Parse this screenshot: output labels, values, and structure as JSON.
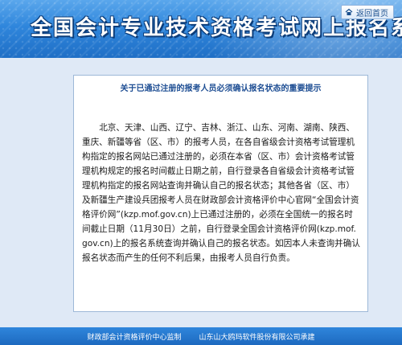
{
  "header": {
    "title": "全国会计专业技术资格考试网上报名系统",
    "home_link": "返回首页",
    "home_icon": "home-icon"
  },
  "notice": {
    "title": "关于已通过注册的报考人员必须确认报名状态的重要提示",
    "body": "北京、天津、山西、辽宁、吉林、浙江、山东、河南、湖南、陕西、重庆、新疆等省（区、市）的报考人员，在各自省级会计资格考试管理机构指定的报名网站已通过注册的，必须在本省（区、市）会计资格考试管理机构规定的报名时间截止日期之前，自行登录各自省级会计资格考试管理机构指定的报名网站查询并确认自己的报名状态；其他各省（区、市）及新疆生产建设兵团报考人员在财政部会计资格评价中心官网“全国会计资格评价网”(kzp.mof.gov.cn)上已通过注册的，必须在全国统一的报名时间截止日期（11月30日）之前，自行登录全国会计资格评价网(kzp.mof.gov.cn)上的报名系统查询并确认自己的报名状态。如因本人未查询并确认报名状态而产生的任何不利后果，由报考人员自行负责。"
  },
  "footer": {
    "supervisor": "财政部会计资格评价中心监制",
    "undertaker": "山东山大鸥玛软件股份有限公司承建"
  }
}
